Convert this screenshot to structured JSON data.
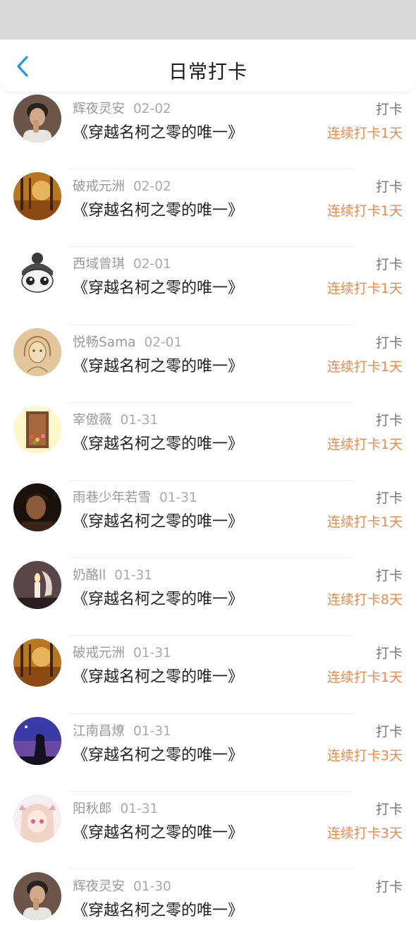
{
  "header": {
    "title": "日常打卡"
  },
  "colors": {
    "accent": "#f0894a",
    "back_icon": "#1e9be8"
  },
  "entries": [
    {
      "name": "辉夜灵安",
      "date": "02-02",
      "book": "《穿越名柯之零的唯一》",
      "action": "打卡",
      "streak": "连续打卡1天",
      "avatar_icon": "portrait-avatar-icon"
    },
    {
      "name": "破戒元洲",
      "date": "02-02",
      "book": "《穿越名柯之零的唯一》",
      "action": "打卡",
      "streak": "连续打卡1天",
      "avatar_icon": "autumn-forest-avatar-icon"
    },
    {
      "name": "西域曾琪",
      "date": "02-01",
      "book": "《穿越名柯之零的唯一》",
      "action": "打卡",
      "streak": "连续打卡1天",
      "avatar_icon": "cartoon-character-avatar-icon"
    },
    {
      "name": "悦畅Sama",
      "date": "02-01",
      "book": "《穿越名柯之零的唯一》",
      "action": "打卡",
      "streak": "连续打卡1天",
      "avatar_icon": "sketch-girl-avatar-icon"
    },
    {
      "name": "宰傲薇",
      "date": "01-31",
      "book": "《穿越名柯之零的唯一》",
      "action": "打卡",
      "streak": "连续打卡1天",
      "avatar_icon": "flower-window-avatar-icon"
    },
    {
      "name": "雨巷少年若雪",
      "date": "01-31",
      "book": "《穿越名柯之零的唯一》",
      "action": "打卡",
      "streak": "连续打卡1天",
      "avatar_icon": "dark-portrait-avatar-icon"
    },
    {
      "name": "奶酪ll",
      "date": "01-31",
      "book": "《穿越名柯之零的唯一》",
      "action": "打卡",
      "streak": "连续打卡8天",
      "avatar_icon": "candle-hand-avatar-icon"
    },
    {
      "name": "破戒元洲",
      "date": "01-31",
      "book": "《穿越名柯之零的唯一》",
      "action": "打卡",
      "streak": "连续打卡1天",
      "avatar_icon": "autumn-forest-avatar-icon"
    },
    {
      "name": "江南昌燎",
      "date": "01-31",
      "book": "《穿越名柯之零的唯一》",
      "action": "打卡",
      "streak": "连续打卡3天",
      "avatar_icon": "night-silhouette-avatar-icon"
    },
    {
      "name": "阳秋郎",
      "date": "01-31",
      "book": "《穿越名柯之零的唯一》",
      "action": "打卡",
      "streak": "连续打卡3天",
      "avatar_icon": "anime-girl-avatar-icon"
    },
    {
      "name": "辉夜灵安",
      "date": "01-30",
      "book": "《穿越名柯之零的唯一》",
      "action": "打卡",
      "streak": "",
      "avatar_icon": "portrait-avatar-icon"
    }
  ]
}
